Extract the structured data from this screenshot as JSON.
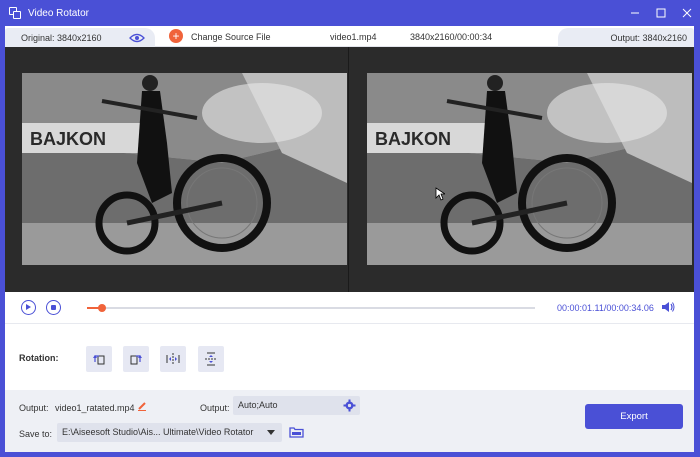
{
  "window": {
    "title": "Video Rotator"
  },
  "infobar": {
    "original": "Original: 3840x2160",
    "change_source": "Change Source File",
    "file_name": "video1.mp4",
    "file_info": "3840x2160/00:00:34",
    "output": "Output: 3840x2160"
  },
  "playback": {
    "current_time": "00:00:01.11",
    "total_time": "00:00:34.06",
    "time_display": "00:00:01.11/00:00:34.06",
    "progress_fraction": 0.033
  },
  "rotation": {
    "label": "Rotation:",
    "buttons": [
      "rotate-left",
      "rotate-right",
      "flip-horizontal",
      "flip-vertical"
    ]
  },
  "output": {
    "output_label": "Output:",
    "file_name": "video1_ratated.mp4",
    "format_label": "Output:",
    "format_value": "Auto;Auto",
    "save_label": "Save to:",
    "save_path": "E:\\Aiseesoft Studio\\Ais... Ultimate\\Video Rotator",
    "export_label": "Export"
  },
  "colors": {
    "accent": "#4a50d6",
    "orange": "#f0633a",
    "panel_bg": "#eef0f5"
  }
}
